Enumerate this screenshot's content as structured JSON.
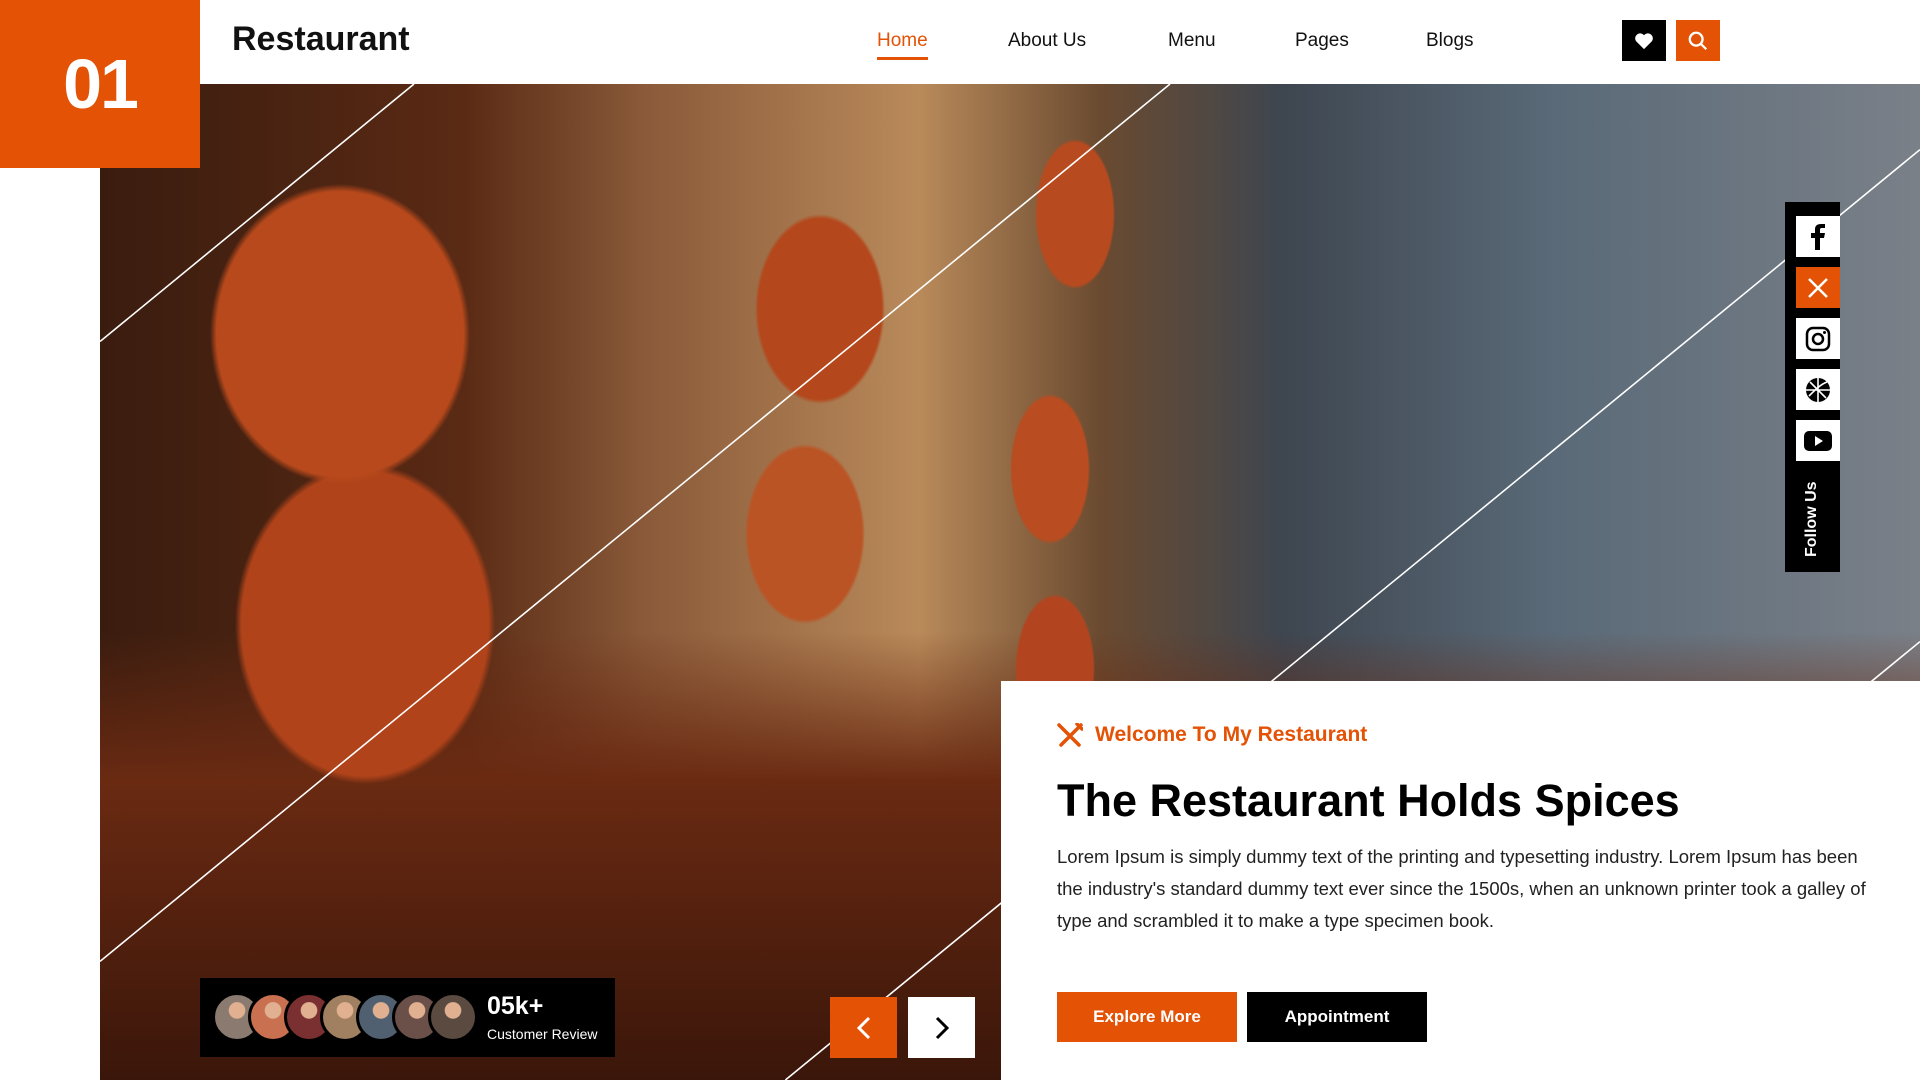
{
  "badge": "01",
  "header": {
    "logo": "Restaurant",
    "nav": [
      {
        "label": "Home",
        "active": true
      },
      {
        "label": "About Us"
      },
      {
        "label": "Menu"
      },
      {
        "label": "Pages"
      },
      {
        "label": "Blogs"
      }
    ],
    "icons": [
      "heart-icon",
      "search-icon"
    ]
  },
  "colors": {
    "accent": "#E35205",
    "dark": "#000000"
  },
  "social": {
    "items": [
      "facebook",
      "x",
      "instagram",
      "dribbble",
      "youtube"
    ],
    "label": "Follow Us"
  },
  "hero": {
    "welcome": "Welcome To My Restaurant",
    "title": "The Restaurant Holds Spices",
    "text": "Lorem Ipsum is simply dummy text of the printing and typesetting industry. Lorem Ipsum has been the industry's standard dummy text ever since the 1500s, when an unknown printer took a galley of type and scrambled it to make a type specimen book.",
    "primary": "Explore More",
    "secondary": "Appointment"
  },
  "review": {
    "count": "05k+",
    "label": "Customer Review"
  }
}
